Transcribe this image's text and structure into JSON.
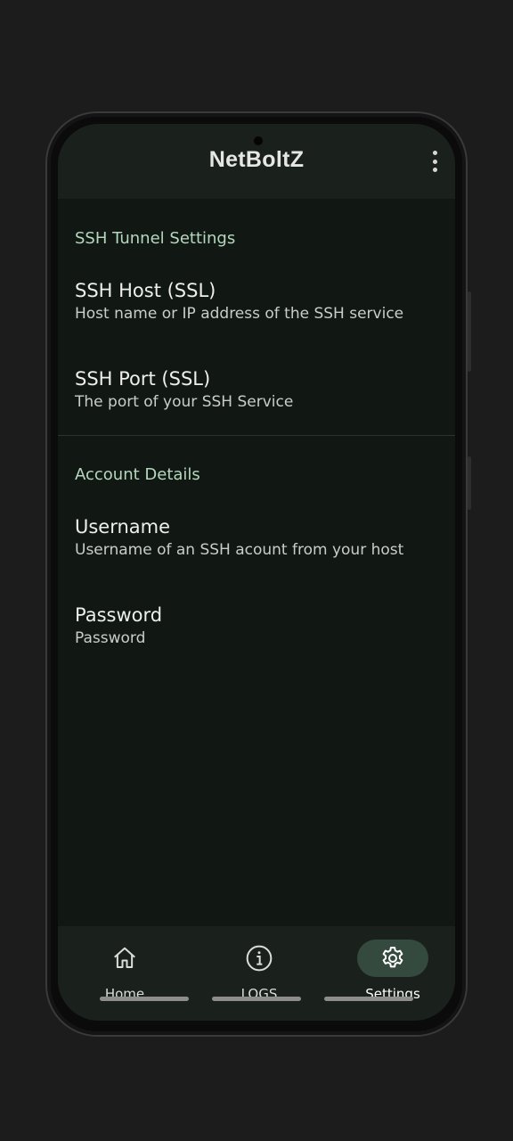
{
  "app": {
    "title": "NetBoltZ",
    "menu_icon": "more-vert-icon"
  },
  "sections": [
    {
      "header": "SSH Tunnel Settings",
      "items": [
        {
          "title": "SSH Host (SSL)",
          "summary": "Host name or IP address of the SSH service"
        },
        {
          "title": "SSH Port (SSL)",
          "summary": "The port of your SSH Service"
        }
      ]
    },
    {
      "header": "Account Details",
      "items": [
        {
          "title": "Username",
          "summary": "Username of an SSH acount from your host"
        },
        {
          "title": "Password",
          "summary": "Password"
        }
      ]
    }
  ],
  "bottom_nav": {
    "items": [
      {
        "label": "Home",
        "icon": "home-icon",
        "active": false
      },
      {
        "label": "LOGS",
        "icon": "info-icon",
        "active": false
      },
      {
        "label": "Settings",
        "icon": "gear-icon",
        "active": true
      }
    ]
  },
  "colors": {
    "background": "#111814",
    "bars": "#1a211d",
    "section_header": "#b5d7bc",
    "active_indicator": "#344a3e"
  }
}
